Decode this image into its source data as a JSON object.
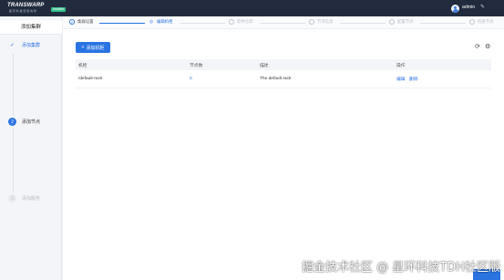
{
  "header": {
    "logo_text": "TRANSWARP",
    "logo_sub": "星 环 科 技 安 装 向 导",
    "logo_badge": "Installer",
    "username": "admin",
    "wrench_icon": "wrench-icon"
  },
  "sidebar": {
    "title": "添加集群",
    "steps": [
      {
        "label": "添加集群",
        "marker": "✓",
        "state": "done"
      },
      {
        "label": "添加节点",
        "marker": "2",
        "state": "active"
      },
      {
        "label": "添加服务",
        "marker": "3",
        "state": "todo"
      }
    ]
  },
  "progress": {
    "steps": [
      {
        "label": "集群设置",
        "marker": "✓",
        "state": "done"
      },
      {
        "label": "编辑机柜",
        "marker": "◎",
        "state": "active"
      },
      {
        "label": "软件仓库",
        "marker": "",
        "state": "todo"
      },
      {
        "label": "节点信息",
        "marker": "",
        "state": "todo"
      },
      {
        "label": "配置节点",
        "marker": "",
        "state": "todo"
      },
      {
        "label": "检查节点",
        "marker": "",
        "state": "todo"
      }
    ]
  },
  "toolbar": {
    "add_label": "添加机柜",
    "add_icon": "+",
    "refresh_icon": "⟳",
    "settings_icon": "⚙"
  },
  "table": {
    "headers": [
      "机柜",
      "节点数",
      "描述",
      "操作"
    ],
    "rows": [
      {
        "rack": "/default-rack",
        "count": "0",
        "description": "The default rack",
        "actions": [
          "编辑",
          "删除"
        ]
      }
    ]
  },
  "watermark": "掘金技术社区 @ 星环科技TDH社区版",
  "colors": {
    "primary": "#2a74e2",
    "topbar": "#222b3d"
  }
}
